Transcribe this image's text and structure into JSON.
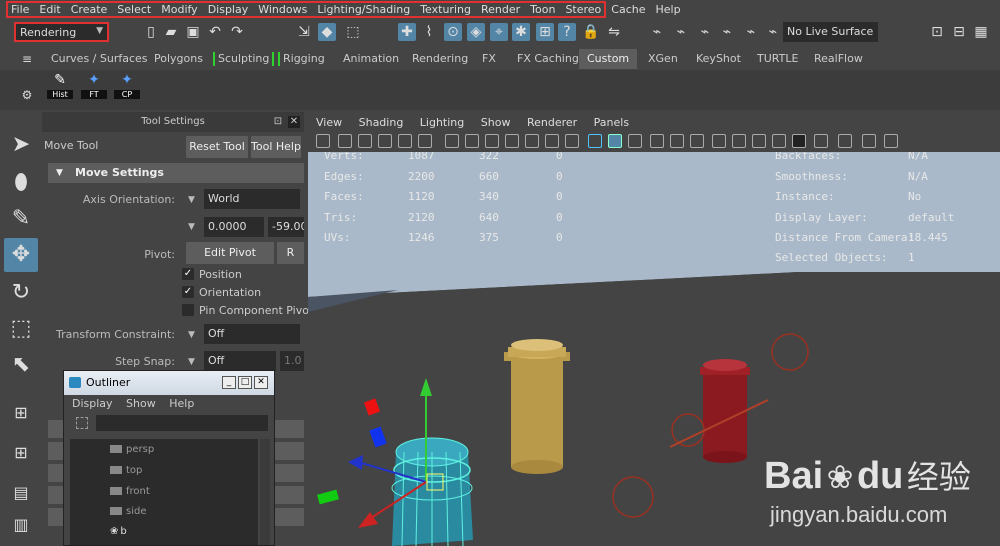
{
  "menubar": {
    "items": [
      "File",
      "Edit",
      "Create",
      "Select",
      "Modify",
      "Display",
      "Windows",
      "Lighting/Shading",
      "Texturing",
      "Render",
      "Toon",
      "Stereo",
      "Cache",
      "Help"
    ]
  },
  "statusline": {
    "mode": "Rendering",
    "live_surface": "No Live Surface"
  },
  "shelf": {
    "tabs": [
      "Curves / Surfaces",
      "Polygons",
      "Sculpting",
      "Rigging",
      "Animation",
      "Rendering",
      "FX",
      "FX Caching",
      "Custom",
      "XGen",
      "KeyShot",
      "TURTLE",
      "RealFlow"
    ],
    "active_tab": "Custom",
    "buttons": [
      "Hist",
      "FT",
      "CP"
    ]
  },
  "tool_settings": {
    "title": "Tool Settings",
    "tool_name": "Move Tool",
    "reset_label": "Reset Tool",
    "help_label": "Tool Help",
    "section": "Move Settings",
    "axis_label": "Axis Orientation:",
    "axis_value": "World",
    "coord_x": "0.0000",
    "coord_y": "-59.00",
    "pivot_label": "Pivot:",
    "edit_pivot": "Edit Pivot",
    "reset_pivot": "R",
    "pivot_options": [
      "Position",
      "Orientation",
      "Pin Component Pivot"
    ],
    "pivot_checked": [
      true,
      true,
      false
    ],
    "transform_label": "Transform Constraint:",
    "transform_value": "Off",
    "step_label": "Step Snap:",
    "step_value": "Off",
    "step_amount": "1.0"
  },
  "outliner": {
    "title": "Outliner",
    "menu": [
      "Display",
      "Show",
      "Help"
    ],
    "items": [
      "persp",
      "top",
      "front",
      "side",
      "b"
    ]
  },
  "viewport": {
    "menu": [
      "View",
      "Shading",
      "Lighting",
      "Show",
      "Renderer",
      "Panels"
    ],
    "hud_left": [
      {
        "label": "Verts:",
        "a": "1087",
        "b": "322",
        "c": "0"
      },
      {
        "label": "Edges:",
        "a": "2200",
        "b": "660",
        "c": "0"
      },
      {
        "label": "Faces:",
        "a": "1120",
        "b": "340",
        "c": "0"
      },
      {
        "label": "Tris:",
        "a": "2120",
        "b": "640",
        "c": "0"
      },
      {
        "label": "UVs:",
        "a": "1246",
        "b": "375",
        "c": "0"
      }
    ],
    "hud_right": [
      {
        "label": "Backfaces:",
        "value": "N/A"
      },
      {
        "label": "Smoothness:",
        "value": "N/A"
      },
      {
        "label": "Instance:",
        "value": "No"
      },
      {
        "label": "Display Layer:",
        "value": "default"
      },
      {
        "label": "Distance From Camera:",
        "value": "18.445"
      },
      {
        "label": "Selected Objects:",
        "value": "1"
      }
    ],
    "watermark_brand": "Bai",
    "watermark_brand2": "du",
    "watermark_cn": "经验",
    "watermark_url": "jingyan.baidu.com"
  }
}
